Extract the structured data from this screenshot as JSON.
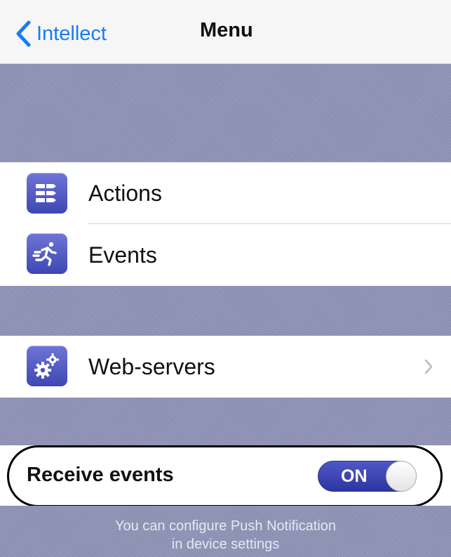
{
  "nav": {
    "back_label": "Intellect",
    "title": "Menu"
  },
  "menu": {
    "items": [
      {
        "label": "Actions",
        "icon": "actions-icon"
      },
      {
        "label": "Events",
        "icon": "running-person-icon"
      }
    ],
    "web_servers": {
      "label": "Web-servers",
      "icon": "gears-icon"
    }
  },
  "settings": {
    "receive_events_label": "Receive events",
    "receive_events_state": "ON",
    "note_line1": "You can configure Push Notification",
    "note_line2": "in device settings"
  },
  "colors": {
    "accent": "#1a7bf7",
    "switch_on": "#3b44b3",
    "band": "#8f93b6"
  }
}
